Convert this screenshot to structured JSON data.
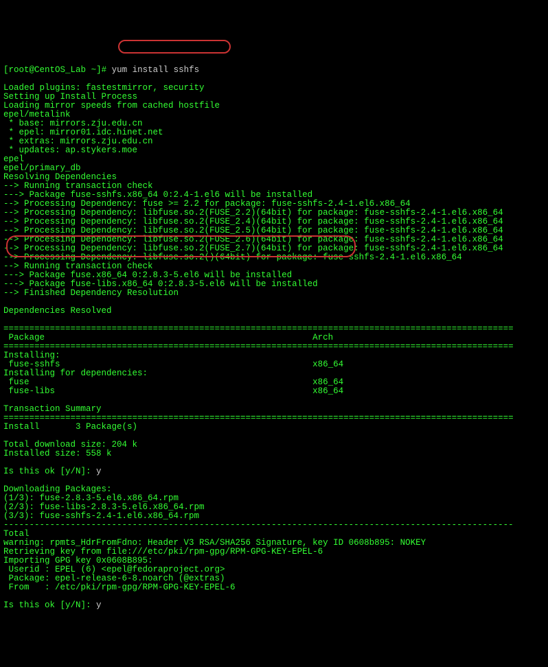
{
  "terminal": {
    "prompt_user": "root@CentOS_Lab",
    "prompt_path": "~",
    "prompt_suffix": "]#",
    "command": "yum install sshfs",
    "lines": [
      "Loaded plugins: fastestmirror, security",
      "Setting up Install Process",
      "Loading mirror speeds from cached hostfile",
      "epel/metalink",
      " * base: mirrors.zju.edu.cn",
      " * epel: mirror01.idc.hinet.net",
      " * extras: mirrors.zju.edu.cn",
      " * updates: ap.stykers.moe",
      "epel",
      "epel/primary_db",
      "Resolving Dependencies",
      "--> Running transaction check",
      "---> Package fuse-sshfs.x86_64 0:2.4-1.el6 will be installed",
      "--> Processing Dependency: fuse >= 2.2 for package: fuse-sshfs-2.4-1.el6.x86_64",
      "--> Processing Dependency: libfuse.so.2(FUSE_2.2)(64bit) for package: fuse-sshfs-2.4-1.el6.x86_64",
      "--> Processing Dependency: libfuse.so.2(FUSE_2.4)(64bit) for package: fuse-sshfs-2.4-1.el6.x86_64",
      "--> Processing Dependency: libfuse.so.2(FUSE_2.5)(64bit) for package: fuse-sshfs-2.4-1.el6.x86_64",
      "--> Processing Dependency: libfuse.so.2(FUSE_2.6)(64bit) for package: fuse-sshfs-2.4-1.el6.x86_64",
      "--> Processing Dependency: libfuse.so.2(FUSE_2.7)(64bit) for package: fuse-sshfs-2.4-1.el6.x86_64",
      "--> Processing Dependency: libfuse.so.2()(64bit) for package: fuse-sshfs-2.4-1.el6.x86_64",
      "--> Running transaction check",
      "---> Package fuse.x86_64 0:2.8.3-5.el6 will be installed",
      "---> Package fuse-libs.x86_64 0:2.8.3-5.el6 will be installed",
      "--> Finished Dependency Resolution",
      "",
      "Dependencies Resolved",
      "",
      "===================================================================================================",
      " Package                                                    Arch ",
      "===================================================================================================",
      "Installing:",
      " fuse-sshfs                                                 x86_64 ",
      "Installing for dependencies:",
      " fuse                                                       x86_64 ",
      " fuse-libs                                                  x86_64 ",
      "",
      "Transaction Summary",
      "===================================================================================================",
      "Install       3 Package(s)",
      "",
      "Total download size: 204 k",
      "Installed size: 558 k"
    ],
    "confirm1_prompt": "Is this ok [y/N]: ",
    "confirm1_answer": "y",
    "lines2": [
      "Downloading Packages:",
      "(1/3): fuse-2.8.3-5.el6.x86_64.rpm",
      "(2/3): fuse-libs-2.8.3-5.el6.x86_64.rpm",
      "(3/3): fuse-sshfs-2.4-1.el6.x86_64.rpm",
      "---------------------------------------------------------------------------------------------------",
      "Total",
      "warning: rpmts_HdrFromFdno: Header V3 RSA/SHA256 Signature, key ID 0608b895: NOKEY",
      "Retrieving key from file:///etc/pki/rpm-gpg/RPM-GPG-KEY-EPEL-6",
      "Importing GPG key 0x0608B895:",
      " Userid : EPEL (6) <epel@fedoraproject.org>",
      " Package: epel-release-6-8.noarch (@extras)",
      " From   : /etc/pki/rpm-gpg/RPM-GPG-KEY-EPEL-6"
    ],
    "confirm2_prompt": "Is this ok [y/N]: ",
    "confirm2_answer": "y"
  }
}
